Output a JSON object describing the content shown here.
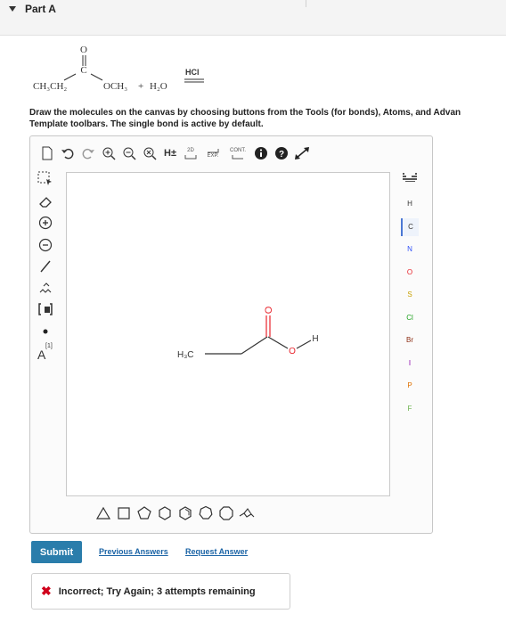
{
  "part": {
    "label": "Part A"
  },
  "reaction": {
    "reactant_left": "CH₃CH₂",
    "carbonyl_o": "O",
    "carbonyl_c": "C",
    "ester_group": "OCH₃",
    "plus": "+",
    "water": "H₂O",
    "reagent": "HCl"
  },
  "instructions": {
    "line1": "Draw the molecules on the canvas by choosing buttons from the Tools (for bonds), Atoms, and Advan",
    "line2": "Template toolbars. The single bond is active by default."
  },
  "editor": {
    "top_toolbar": {
      "h_toggle": "H±",
      "view_2d": "2D",
      "expand": "EXP.",
      "contract": "CONT."
    },
    "left_toolbar": {
      "charge_label": "[1]",
      "atom_label": "A"
    },
    "canvas_molecule": {
      "left_group": "H₃C",
      "carbonyl_o": "O",
      "hydroxyl_o": "O",
      "hydrogen": "H"
    },
    "atoms": [
      "H",
      "C",
      "N",
      "O",
      "S",
      "Cl",
      "Br",
      "I",
      "P",
      "F"
    ],
    "active_atom": "C",
    "atom_colors": {
      "H": "#333333",
      "C": "#333333",
      "N": "#3050f8",
      "O": "#e8232b",
      "S": "#c8a000",
      "Cl": "#1ca01c",
      "Br": "#8b2a10",
      "I": "#8800aa",
      "P": "#e07000",
      "F": "#6ab04c"
    }
  },
  "actions": {
    "submit": "Submit",
    "previous_answers": "Previous Answers",
    "request_answer": "Request Answer"
  },
  "feedback": {
    "icon": "✖",
    "message": "Incorrect; Try Again; 3 attempts remaining"
  }
}
